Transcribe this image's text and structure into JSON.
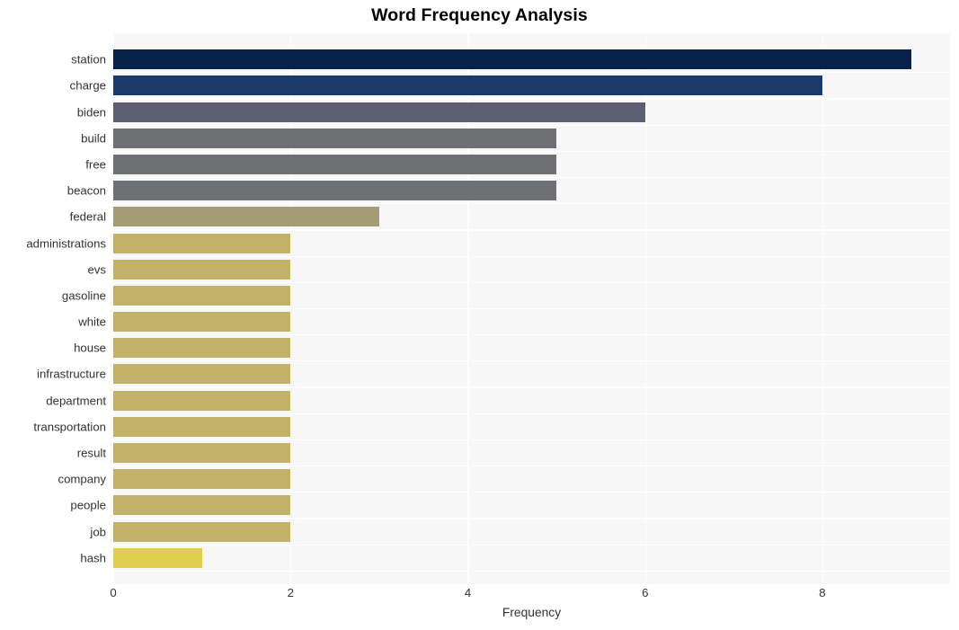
{
  "chart_data": {
    "type": "bar",
    "orientation": "horizontal",
    "title": "Word Frequency Analysis",
    "xlabel": "Frequency",
    "ylabel": "",
    "xlim": [
      0,
      9.44
    ],
    "xticks": [
      0,
      2,
      4,
      6,
      8
    ],
    "xticklabels": [
      "0",
      "2",
      "4",
      "6",
      "8"
    ],
    "grid": "vertical-white-on-light-gray",
    "legend": "none",
    "categories": [
      "station",
      "charge",
      "biden",
      "build",
      "free",
      "beacon",
      "federal",
      "administrations",
      "evs",
      "gasoline",
      "white",
      "house",
      "infrastructure",
      "department",
      "transportation",
      "result",
      "company",
      "people",
      "job",
      "hash"
    ],
    "values": [
      9,
      8,
      6,
      5,
      5,
      5,
      3,
      2,
      2,
      2,
      2,
      2,
      2,
      2,
      2,
      2,
      2,
      2,
      2,
      1
    ],
    "bar_colors": [
      "#06214a",
      "#1b3a6b",
      "#5c5f72",
      "#6f7073",
      "#6f7073",
      "#6f7073",
      "#a39c74",
      "#c2b168",
      "#c2b168",
      "#c2b168",
      "#c2b168",
      "#c2b168",
      "#c2b168",
      "#c2b168",
      "#c2b168",
      "#c2b168",
      "#c2b168",
      "#c2b168",
      "#c2b168",
      "#e0ce4e"
    ]
  },
  "style": {
    "plot_background": "#f7f7f7",
    "figure_background": "#ffffff",
    "gridline_color": "#ffffff",
    "tick_label_color": "#333333",
    "title_color": "#000000"
  }
}
